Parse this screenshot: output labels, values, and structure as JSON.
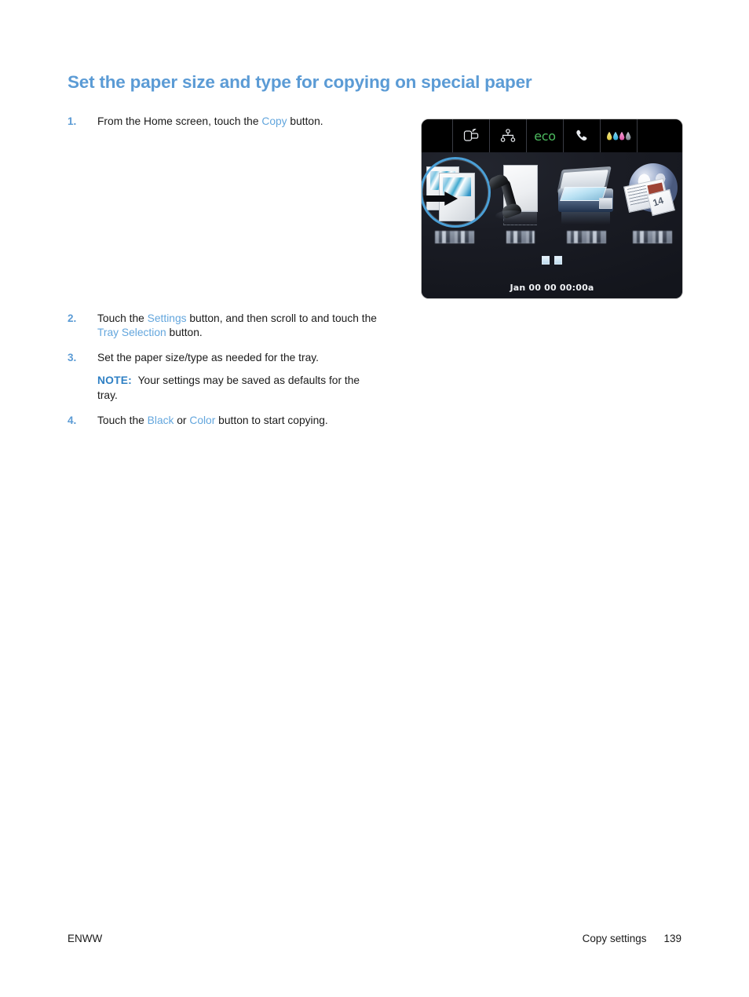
{
  "document": {
    "heading": "Set the paper size and type for copying on special paper"
  },
  "steps": [
    {
      "number": "1.",
      "segments": [
        {
          "text": "From the Home screen, touch the ",
          "style": "plain"
        },
        {
          "text": "Copy",
          "style": "link"
        },
        {
          "text": " button.",
          "style": "plain"
        }
      ]
    },
    {
      "number": "2.",
      "segments": [
        {
          "text": "Touch the ",
          "style": "plain"
        },
        {
          "text": "Settings",
          "style": "link"
        },
        {
          "text": " button, and then scroll to and touch the ",
          "style": "plain"
        },
        {
          "text": "Tray Selection",
          "style": "link"
        },
        {
          "text": " button.",
          "style": "plain"
        }
      ]
    },
    {
      "number": "3.",
      "segments": [
        {
          "text": "Set the paper size/type as needed for the tray.",
          "style": "plain"
        }
      ]
    },
    {
      "number": "4.",
      "segments": [
        {
          "text": "Touch the ",
          "style": "plain"
        },
        {
          "text": "Black",
          "style": "link"
        },
        {
          "text": " or ",
          "style": "plain"
        },
        {
          "text": "Color",
          "style": "link"
        },
        {
          "text": " button to start copying.",
          "style": "plain"
        }
      ]
    }
  ],
  "note": {
    "label": "NOTE:",
    "text": "Your settings may be saved as defaults for the tray."
  },
  "control_panel": {
    "status_bar": [
      {
        "icon": "wireless-direct-icon",
        "label": ""
      },
      {
        "icon": "network-icon",
        "label": ""
      },
      {
        "icon": "eco-icon",
        "label": "eco"
      },
      {
        "icon": "fax-phone-icon",
        "label": ""
      },
      {
        "icon": "ink-levels-icon",
        "label": ""
      }
    ],
    "ink_colors": [
      "#e8d24a",
      "#3fb6e0",
      "#e267b4",
      "#8d949c"
    ],
    "eco_color": "#4cbb5f",
    "home_icons": [
      {
        "name": "copy-icon",
        "caption": "",
        "highlighted": true
      },
      {
        "name": "fax-icon",
        "caption": "",
        "highlighted": false
      },
      {
        "name": "scan-icon",
        "caption": "",
        "highlighted": false
      },
      {
        "name": "apps-web-icon",
        "caption": "",
        "highlighted": false
      }
    ],
    "apps_calendar_number": "14",
    "page_dots": 2,
    "status_text": "Jan 00 00 00:00a",
    "highlight_color": "#4b9fd6"
  },
  "footer": {
    "left": "ENWW",
    "section": "Copy settings",
    "page_number": "139"
  },
  "colors": {
    "heading": "#5b9bd5",
    "link": "#63a6dd",
    "note_label": "#2f80c4",
    "body_text": "#1a1a1a"
  }
}
